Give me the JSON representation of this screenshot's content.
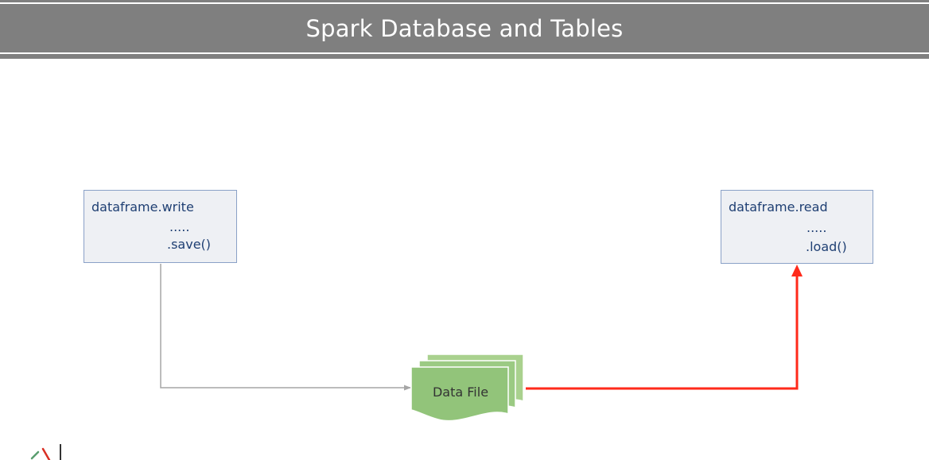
{
  "title": "Spark Database and Tables",
  "write_box": {
    "line1": "dataframe.write",
    "line2": ".....",
    "line3": ".save()"
  },
  "read_box": {
    "line1": "dataframe.read",
    "line2": ".....",
    "line3": ".load()"
  },
  "data_file": {
    "label": "Data File"
  },
  "colors": {
    "banner": "#7f7f7f",
    "box_fill": "#eef0f4",
    "box_border": "#8aa1c7",
    "box_text": "#1f3f73",
    "file_fill": "#92c47a",
    "write_arrow": "#a6a6a6",
    "read_arrow": "#ff2a1a"
  }
}
